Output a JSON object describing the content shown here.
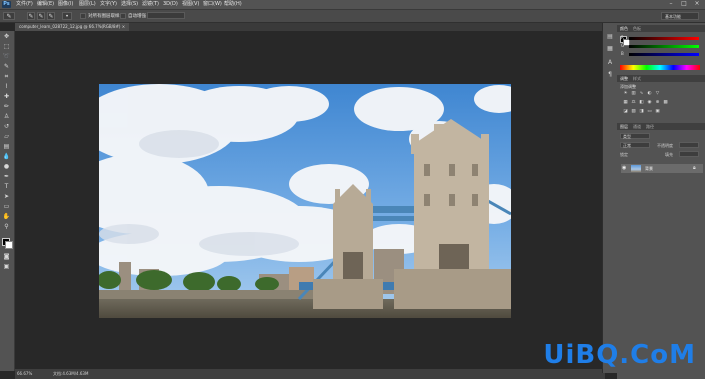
{
  "app": {
    "logo": "Ps"
  },
  "menu": [
    "文件(F)",
    "编辑(E)",
    "图像(I)",
    "图层(L)",
    "文字(Y)",
    "选择(S)",
    "滤镜(T)",
    "3D(D)",
    "视图(V)",
    "窗口(W)",
    "帮助(H)"
  ],
  "window_controls": {
    "minimize": "–",
    "maximize": "□",
    "close": "×"
  },
  "options_bar": {
    "mode_label": "对所有图层取样",
    "auto_enhance_label": "自动增强",
    "workspace": "基本功能"
  },
  "document": {
    "tab_title": "computer_learn_028722_12.jpg @ 66.7%(RGB/8#) ×"
  },
  "status": {
    "zoom": "66.67%",
    "doc_size": "文档:4.63M/4.63M"
  },
  "panels": {
    "color_tabs": [
      "颜色",
      "色板"
    ],
    "color_channels": [
      "R",
      "G",
      "B"
    ],
    "adjust_tabs": [
      "调整",
      "样式"
    ],
    "adjust_title": "添加调整",
    "layers_tabs": [
      "图层",
      "通道",
      "路径"
    ],
    "layer_kind": "类型",
    "blend_mode": "正常",
    "opacity_label": "不透明度",
    "lock_label": "锁定",
    "fill_label": "填充",
    "layer_name": "背景"
  },
  "colors": {
    "accent": "#1f7ee8"
  },
  "watermark": "UiBQ.CoM"
}
